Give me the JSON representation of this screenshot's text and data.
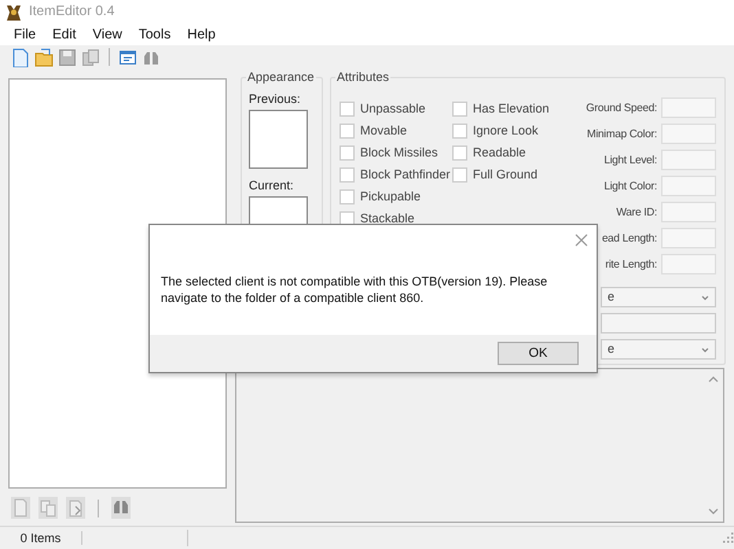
{
  "window": {
    "title": "ItemEditor 0.4"
  },
  "menu": [
    {
      "label": "File"
    },
    {
      "label": "Edit"
    },
    {
      "label": "View"
    },
    {
      "label": "Tools"
    },
    {
      "label": "Help"
    }
  ],
  "appearance": {
    "title": "Appearance",
    "previous_label": "Previous:",
    "current_label": "Current:"
  },
  "attributes": {
    "title": "Attributes",
    "flags": [
      {
        "label": "Unpassable",
        "checked": false
      },
      {
        "label": "Movable",
        "checked": false
      },
      {
        "label": "Block Missiles",
        "checked": false
      },
      {
        "label": "Block Pathfinder",
        "checked": false
      },
      {
        "label": "Pickupable",
        "checked": false
      },
      {
        "label": "Stackable",
        "checked": false
      },
      {
        "label": "Has Elevation",
        "checked": false
      },
      {
        "label": "Ignore Look",
        "checked": false
      },
      {
        "label": "Readable",
        "checked": false
      },
      {
        "label": "Full Ground",
        "checked": false
      }
    ],
    "properties": [
      {
        "label": "Ground Speed:"
      },
      {
        "label": "Minimap Color:"
      },
      {
        "label": "Light Level:"
      },
      {
        "label": "Light Color:"
      },
      {
        "label": "Ware ID:"
      },
      {
        "label": "ead Length:"
      },
      {
        "label": "rite Length:"
      }
    ],
    "selectors": [
      {
        "kind": "dropdown",
        "value": "e"
      },
      {
        "kind": "text"
      },
      {
        "kind": "dropdown",
        "value": "e"
      }
    ]
  },
  "status_bar": {
    "count": "0 Items"
  },
  "dialog": {
    "message": "The selected client is not compatible with this OTB(version 19). Please navigate to the folder of a compatible client 860.",
    "button": "OK"
  }
}
